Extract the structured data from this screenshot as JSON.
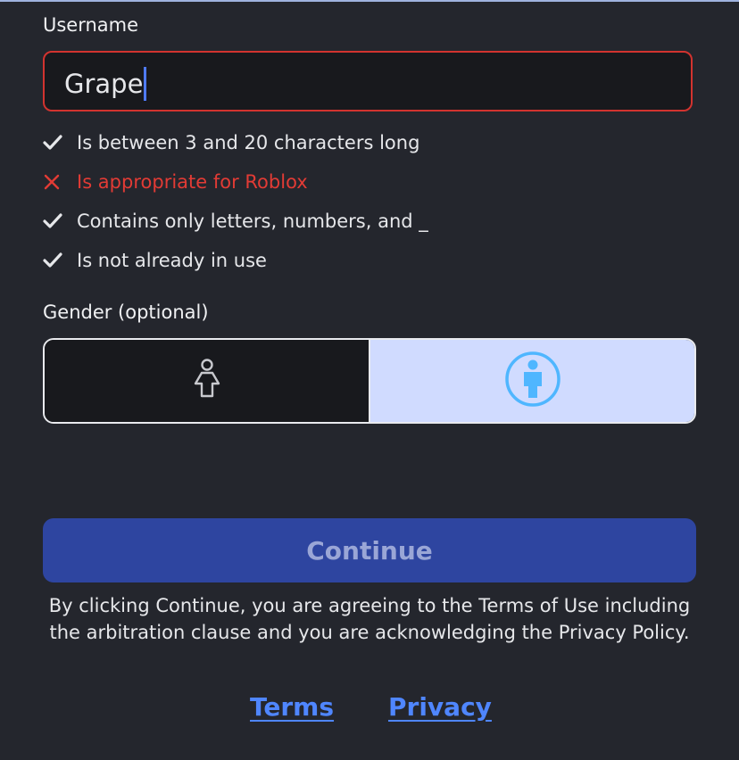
{
  "form": {
    "username_label": "Username",
    "username_value": "Grape",
    "rules": [
      {
        "status": "ok",
        "text": "Is between 3 and 20 characters long"
      },
      {
        "status": "fail",
        "text": "Is appropriate for Roblox"
      },
      {
        "status": "ok",
        "text": "Contains only letters, numbers, and _"
      },
      {
        "status": "ok",
        "text": "Is not already in use"
      }
    ],
    "gender_label": "Gender (optional)",
    "gender_options": [
      "female-icon",
      "male-icon"
    ],
    "gender_selected": "male"
  },
  "actions": {
    "continue_label": "Continue"
  },
  "legal": {
    "text": "By clicking Continue, you are agreeing to the Terms of Use including the arbitration clause and you are acknowledging the Privacy Policy."
  },
  "links": {
    "terms": "Terms",
    "privacy": "Privacy"
  },
  "colors": {
    "background": "#24262d",
    "error": "#d2332f",
    "accent": "#4f86ff",
    "button": "#2e45a0",
    "selected": "#d0dbff",
    "male_icon": "#4fb6ff"
  }
}
